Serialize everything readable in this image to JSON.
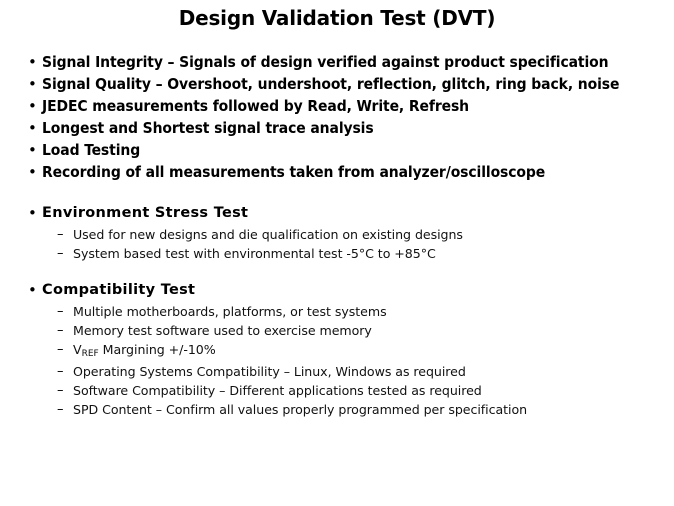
{
  "slide": {
    "title": "Design Validation Test (DVT)",
    "background_color": "#ffffff",
    "text_color": "#000000",
    "bullet_glyph": "•",
    "dash_glyph": "–",
    "main_bullets": [
      {
        "text": "Signal Integrity  –  Signals  of design  verified  against  product specification"
      },
      {
        "text": "Signal Quality  –  Overshoot, undershoot,  reflection,  glitch,  ring back, noise"
      },
      {
        "text": "JEDEC measurements  followed  by Read, Write,  Refresh"
      },
      {
        "text": "Longest and Shortest signal  trace analysis"
      },
      {
        "text": "Load Testing"
      },
      {
        "text": "Recording of all  measurements  taken from analyzer/oscilloscope"
      }
    ],
    "sections": [
      {
        "heading": "Environment  Stress Test",
        "items": [
          {
            "text": "Used for new designs and die qualification  on existing designs"
          },
          {
            "text": "System based test with environmental  test -5°C to +85°C"
          }
        ]
      },
      {
        "heading": "Compatibility  Test",
        "items": [
          {
            "text": "Multiple  motherboards, platforms,  or test systems"
          },
          {
            "text": "Memory  test software used to exercise memory"
          },
          {
            "text_prefix": "V",
            "subscript": "REF",
            "text_suffix": " Margining  +/-10%"
          },
          {
            "text": "Operating Systems Compatibility  –  Linux, Windows as required"
          },
          {
            "text": "Software Compatibility  –  Different applications tested as required"
          },
          {
            "text": "SPD Content – Confirm  all  values properly programmed per specification"
          }
        ]
      }
    ]
  }
}
